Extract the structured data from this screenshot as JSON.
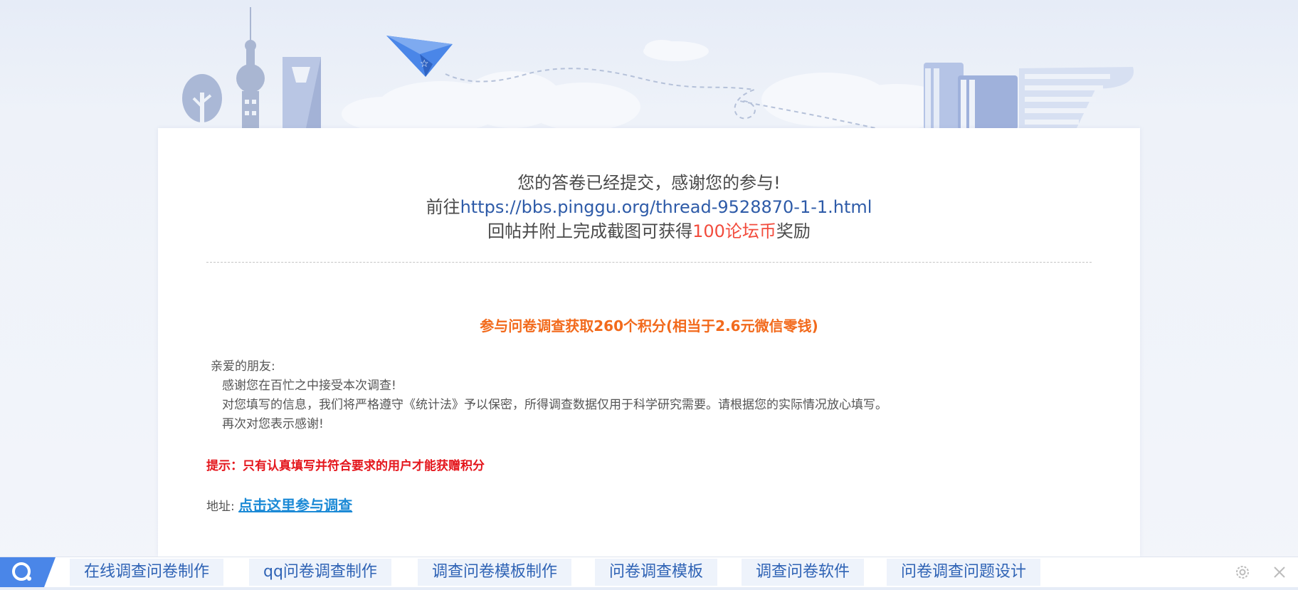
{
  "confirmation": {
    "line1": "您的答卷已经提交，感谢您的参与!",
    "line2_prefix": "前往",
    "line2_link": "https://bbs.pinggu.org/thread-9528870-1-1.html",
    "line3_prefix": "回帖并附上完成截图可获得",
    "line3_reward": "100论坛币",
    "line3_suffix": "奖励"
  },
  "offer": "参与问卷调查获取260个积分(相当于2.6元微信零钱)",
  "intro": {
    "greeting": "亲爱的朋友:",
    "line1": "感谢您在百忙之中接受本次调查!",
    "line2": "对您填写的信息，我们将严格遵守《统计法》予以保密，所得调查数据仅用于科学研究需要。请根据您的实际情况放心填写。",
    "line3": "再次对您表示感谢!"
  },
  "hint": "提示：只有认真填写并符合要求的用户才能获赠积分",
  "address": {
    "label": "地址:",
    "link": "点击这里参与调查"
  },
  "bottom_bar": {
    "logo_icon": "search-logo-icon",
    "chips": [
      "在线调查问卷制作",
      "qq问卷调查制作",
      "调查问卷模板制作",
      "问卷调查模板",
      "调查问卷软件",
      "问卷调查问题设计"
    ],
    "settings_icon": "gear-icon",
    "close_icon": "close-icon"
  },
  "colors": {
    "link": "#2e5ba8",
    "reward": "#f24c3d",
    "offer": "#f26a1c",
    "hint": "#e4161c",
    "address_link": "#1c8ad6",
    "chip_text": "#2f63b5",
    "logo_blue": "#4a86e8"
  }
}
